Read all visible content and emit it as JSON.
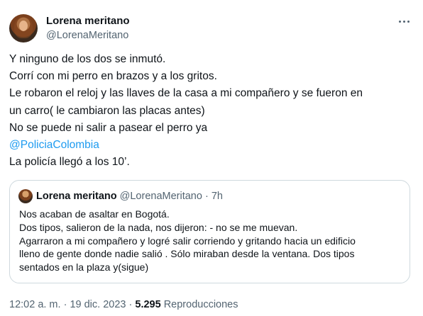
{
  "author": {
    "name": "Lorena meritano",
    "handle": "@LorenaMeritano"
  },
  "more_icon": "more-horizontal-icon",
  "tweet": {
    "lines": [
      "Y ninguno de los dos se inmutó.",
      "Corrí con mi perro en brazos y a los gritos.",
      "Le robaron el reloj  y las llaves de la casa a mi compañero y se fueron en",
      "un carro( le cambiaron las placas antes)",
      "No se puede ni salir a pasear el perro ya"
    ],
    "mention": "@PoliciaColombia",
    "last_line": "La policía llegó a los 10’."
  },
  "quote": {
    "name": "Lorena meritano",
    "handle": "@LorenaMeritano",
    "separator": "·",
    "time": "7h",
    "lines": [
      "Nos acaban de asaltar en Bogotá.",
      "Dos tipos, salieron de la nada, nos dijeron: - no se me muevan.",
      "Agarraron a mi compañero y logré salir corriendo y gritando hacia un edificio",
      "lleno de gente donde nadie salió . Sólo miraban desde la ventana. Dos tipos",
      "sentados en la plaza y(sigue)"
    ]
  },
  "footer": {
    "time": "12:02 a. m.",
    "sep1": "·",
    "date": "19 dic. 2023",
    "sep2": "·",
    "views_count": "5.295",
    "views_label": "Reproducciones"
  },
  "colors": {
    "link": "#1d9bf0",
    "secondary_text": "#536471",
    "border": "#cfd9de"
  }
}
